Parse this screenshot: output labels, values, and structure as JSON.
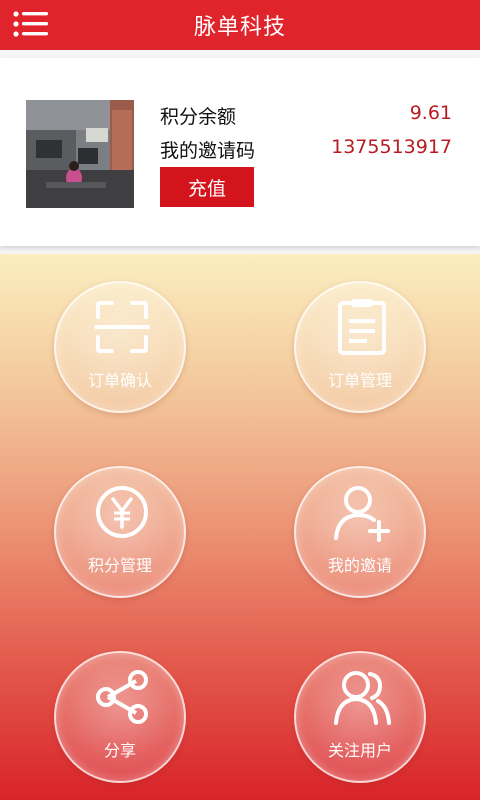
{
  "header": {
    "title": "脉单科技",
    "menu_icon": "menu-list-icon",
    "color": "#e0242c"
  },
  "account": {
    "avatar": "office-photo",
    "balance_label": "积分余额",
    "balance_value": "9.61",
    "invite_label": "我的邀请码",
    "invite_value": "1375513917",
    "recharge_label": "充值",
    "accent_color": "#d4141c"
  },
  "menu": {
    "items": [
      {
        "label": "订单确认",
        "icon": "scan-icon"
      },
      {
        "label": "订单管理",
        "icon": "clipboard-icon"
      },
      {
        "label": "积分管理",
        "icon": "yen-coin-icon"
      },
      {
        "label": "我的邀请",
        "icon": "add-user-icon"
      },
      {
        "label": "分享",
        "icon": "share-icon"
      },
      {
        "label": "关注用户",
        "icon": "users-icon"
      }
    ]
  }
}
